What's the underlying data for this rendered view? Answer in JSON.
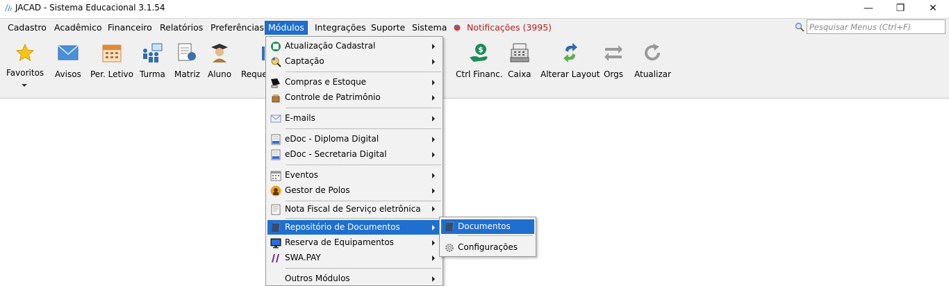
{
  "window": {
    "title": "JACAD - Sistema Educacional 3.1.54",
    "minimize_glyph": "—",
    "maximize_glyph": "❐",
    "close_glyph": "✕"
  },
  "menubar": {
    "items": [
      "Cadastro",
      "Acadêmico",
      "Financeiro",
      "Relatórios",
      "Preferências",
      "Módulos",
      "Integrações",
      "Suporte",
      "Sistema"
    ],
    "active": "Módulos",
    "notifications": "Notificações (3995)"
  },
  "search": {
    "placeholder": "Pesquisar Menus (Ctrl+F)"
  },
  "toolbar": {
    "items": [
      {
        "label": "Favoritos",
        "icon": "star-icon"
      },
      {
        "label": "Avisos",
        "icon": "envelope-icon"
      },
      {
        "label": "Per. Letivo",
        "icon": "calendar-icon"
      },
      {
        "label": "Turma",
        "icon": "class-group-icon"
      },
      {
        "label": "Matriz",
        "icon": "matrix-doc-icon"
      },
      {
        "label": "Aluno",
        "icon": "student-icon"
      },
      {
        "label": "Reque",
        "icon": "request-icon"
      },
      {
        "label": "Ctrl Financ.",
        "icon": "money-hand-icon"
      },
      {
        "label": "Caixa",
        "icon": "cash-register-icon"
      },
      {
        "label": "Alterar Layout",
        "icon": "swap-layout-icon"
      },
      {
        "label": "Orgs",
        "icon": "arrows-icon"
      },
      {
        "label": "Atualizar",
        "icon": "refresh-icon"
      }
    ]
  },
  "modulos_menu": {
    "items": [
      {
        "label": "Atualização Cadastral",
        "icon": "profile-update-icon"
      },
      {
        "label": "Captação",
        "icon": "magnifier-person-icon"
      },
      {
        "label": "Compras e Estoque",
        "icon": "shopping-icon"
      },
      {
        "label": "Controle de Patrimônio",
        "icon": "chest-icon"
      },
      {
        "label": "E-mails",
        "icon": "email-icon"
      },
      {
        "label": "eDoc - Diploma Digital",
        "icon": "doc-icon"
      },
      {
        "label": "eDoc - Secretaria Digital",
        "icon": "doc-icon"
      },
      {
        "label": "Eventos",
        "icon": "events-calendar-icon"
      },
      {
        "label": "Gestor de Polos",
        "icon": "polos-avatar-icon"
      },
      {
        "label": "Nota Fiscal de Serviço eletrônica",
        "icon": "invoice-icon"
      },
      {
        "label": "Repositório de Documentos",
        "icon": "repository-icon"
      },
      {
        "label": "Reserva de Equipamentos",
        "icon": "monitor-icon"
      },
      {
        "label": "SWA.PAY",
        "icon": "swapay-icon"
      },
      {
        "label": "Outros Módulos",
        "icon": ""
      }
    ],
    "highlighted": "Repositório de Documentos"
  },
  "repositorio_submenu": {
    "items": [
      {
        "label": "Documentos",
        "icon": "repository-icon"
      },
      {
        "label": "Configurações",
        "icon": "gear-icon"
      }
    ],
    "highlighted": "Documentos"
  },
  "colors": {
    "highlight": "#1e6fd0",
    "notification": "#b31b1b",
    "chrome": "#f0f0f0"
  }
}
